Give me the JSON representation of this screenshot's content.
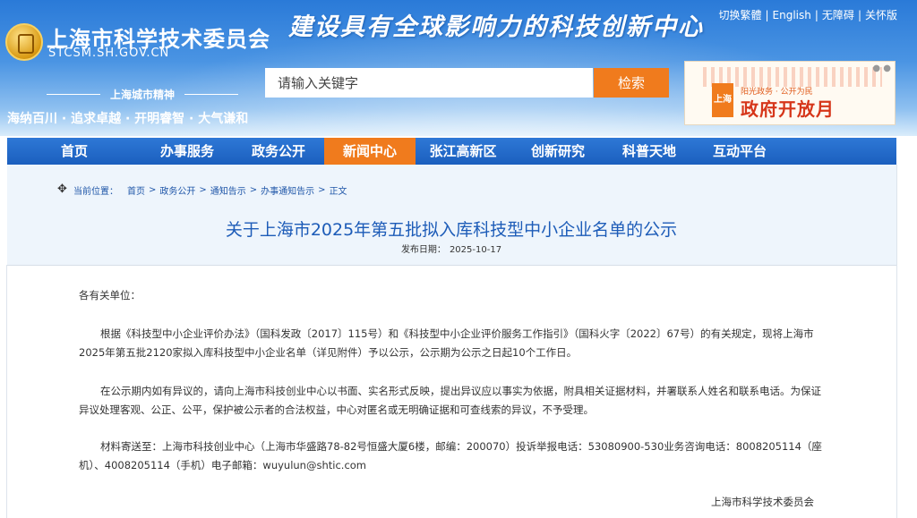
{
  "header": {
    "site_name": "上海市科学技术委员会",
    "site_domain": "STCSM.SH.GOV.CN",
    "slogan": "建设具有全球影响力的科技创新中心",
    "top_links": [
      "切换繁體",
      "English",
      "无障碍",
      "关怀版"
    ],
    "spirit_title": "上海城市精神",
    "spirit_text": "海纳百川 · 追求卓越 · 开明睿智 · 大气谦和",
    "banner": {
      "badge": "上海",
      "small_text": "阳光政务 · 公开为民",
      "big_text": "政府开放月"
    }
  },
  "search": {
    "placeholder": "请输入关键字",
    "button_label": "检索"
  },
  "nav": {
    "items": [
      "首页",
      "办事服务",
      "政务公开",
      "新闻中心",
      "张江高新区",
      "创新研究",
      "科普天地",
      "互动平台"
    ],
    "active_index": 3
  },
  "breadcrumb": {
    "label": "当前位置：",
    "items": [
      "首页",
      "政务公开",
      "通知告示",
      "办事通知告示",
      "正文"
    ]
  },
  "article": {
    "title": "关于上海市2025年第五批拟入库科技型中小企业名单的公示",
    "date_label": "发布日期：",
    "date": "2025-10-17",
    "salutation": "各有关单位：",
    "paragraphs": [
      "根据《科技型中小企业评价办法》（国科发政〔2017〕115号）和《科技型中小企业评价服务工作指引》（国科火字〔2022〕67号）的有关规定，现将上海市2025年第五批2120家拟入库科技型中小企业名单（详见附件）予以公示，公示期为公示之日起10个工作日。",
      "在公示期内如有异议的，请向上海市科技创业中心以书面、实名形式反映，提出异议应以事实为依据，附具相关证据材料，并署联系人姓名和联系电话。为保证异议处理客观、公正、公平，保护被公示者的合法权益，中心对匿名或无明确证据和可查线索的异议，不予受理。",
      "材料寄送至：上海市科技创业中心（上海市华盛路78-82号恒盛大厦6楼，邮编：200070）投诉举报电话：53080900-530业务咨询电话：8008205114（座机）、4008205114（手机）电子邮箱：wuyulun@shtic.com"
    ],
    "signature": "上海市科学技术委员会"
  },
  "colors": {
    "header_blue": "#2a7ad8",
    "nav_blue": "#1c63c4",
    "accent_orange": "#f07b1d",
    "title_blue": "#1d5cb8"
  }
}
